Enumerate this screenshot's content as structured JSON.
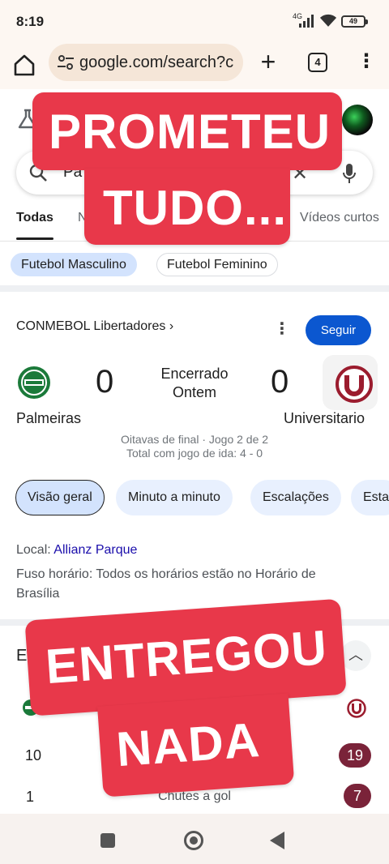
{
  "status_bar": {
    "time": "8:19",
    "network": "4G",
    "battery": "49"
  },
  "browser": {
    "url": "google.com/search?c",
    "tab_count": "4"
  },
  "search": {
    "query": "Pa"
  },
  "tabs": [
    {
      "label": "Todas",
      "active": true
    },
    {
      "label": "N",
      "active": false
    },
    {
      "label": "Vídeos curtos",
      "active": false
    }
  ],
  "chips": [
    {
      "label": "Futebol Masculino",
      "selected": true
    },
    {
      "label": "Futebol Feminino",
      "selected": false
    }
  ],
  "match": {
    "league": "CONMEBOL Libertadores",
    "league_chevron": "›",
    "follow_label": "Seguir",
    "home_team": "Palmeiras",
    "away_team": "Universitario",
    "home_score": "0",
    "away_score": "0",
    "status": "Encerrado",
    "date": "Ontem",
    "stage": "Oitavas de final · Jogo 2 de 2",
    "aggregate": "Total com jogo de ida: 4 - 0"
  },
  "match_tabs": [
    "Visão geral",
    "Minuto a minuto",
    "Escalações",
    "Esta"
  ],
  "venue": {
    "label": "Local:",
    "value": "Allianz Parque",
    "tz_label": "Fuso horário:",
    "tz_value_line1": "Todos os horários estão no Horário de",
    "tz_value_line2": "Brasília"
  },
  "stats": {
    "heading_partial": "Es",
    "rows": [
      {
        "home": "10",
        "away": "19",
        "label": ""
      },
      {
        "home": "1",
        "away": "7",
        "label": "Chutes a gol"
      }
    ]
  },
  "overlays": {
    "top_line1": "PROMETEU",
    "top_line2": "TUDO...",
    "bottom_line1": "ENTREGOU",
    "bottom_line2": "NADA"
  },
  "colors": {
    "overlay_red": "#e8384a",
    "follow_blue": "#0b57d0",
    "away_badge": "#7a2339"
  }
}
